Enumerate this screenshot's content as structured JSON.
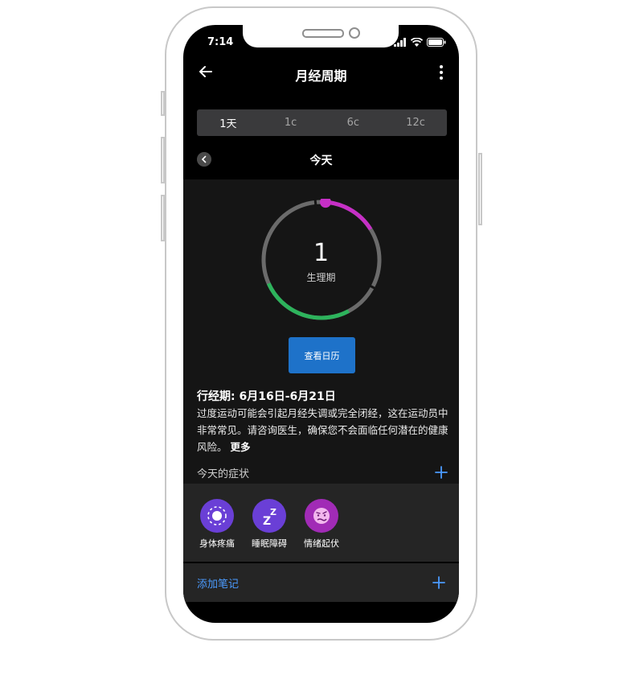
{
  "status": {
    "time": "7:14"
  },
  "nav": {
    "title": "月经周期"
  },
  "segments": [
    "1天",
    "1c",
    "6c",
    "12c"
  ],
  "date_nav": {
    "label": "今天"
  },
  "ring": {
    "day": "1",
    "phase": "生理期",
    "period_color": "#c62fc6",
    "fertile_color": "#2db35c",
    "track_color": "#6b6b6b"
  },
  "calendar_button": "查看日历",
  "period": {
    "title": "行经期: 6月16日-6月21日",
    "description": "过度运动可能会引起月经失调或完全闭经，这在运动员中非常常见。请咨询医生，确保您不会面临任何潜在的健康风险。",
    "more": "更多"
  },
  "symptoms": {
    "label": "今天的症状",
    "items": [
      {
        "name": "身体疼痛",
        "icon": "body-ache-icon",
        "color": "#6a3fd6"
      },
      {
        "name": "睡眠障碍",
        "icon": "sleep-icon",
        "color": "#6a3fd6"
      },
      {
        "name": "情绪起伏",
        "icon": "mood-icon",
        "color": "#a12bb6"
      }
    ]
  },
  "notes": {
    "label": "添加笔记"
  },
  "colors": {
    "accent_blue": "#4b9bff",
    "button_blue": "#1e72c9"
  }
}
